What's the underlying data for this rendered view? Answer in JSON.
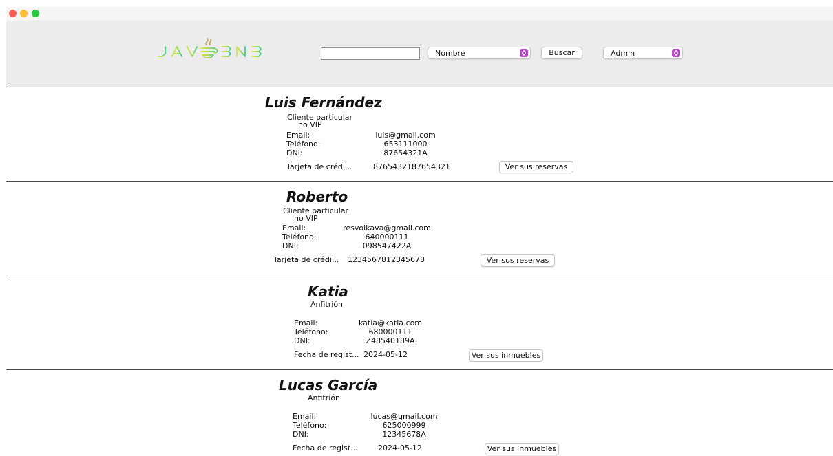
{
  "logo": {
    "text": "JAVABNB"
  },
  "header": {
    "search": {
      "value": "",
      "placeholder": ""
    },
    "filter_select": {
      "selected": "Nombre"
    },
    "search_button": "Buscar",
    "role_select": {
      "selected": "Admin"
    }
  },
  "users": [
    {
      "name": "Luis Fernández",
      "type_line1": "Cliente particular",
      "type_line2": "no VIP",
      "email_label": "Email:",
      "email": "luis@gmail.com",
      "phone_label": "Teléfono:",
      "phone": "653111000",
      "dni_label": "DNI:",
      "dni": "87654321A",
      "extra_label": "Tarjeta de crédi...",
      "extra_value": "8765432187654321",
      "action": "Ver sus reservas"
    },
    {
      "name": "Roberto",
      "type_line1": "Cliente particular",
      "type_line2": "no VIP",
      "email_label": "Email:",
      "email": "resvolkava@gmail.com",
      "phone_label": "Teléfono:",
      "phone": "640000111",
      "dni_label": "DNI:",
      "dni": "098547422A",
      "extra_label": "Tarjeta de crédi...",
      "extra_value": "1234567812345678",
      "action": "Ver sus reservas"
    },
    {
      "name": "Katia",
      "type_line1": "Anfitrión",
      "email_label": "Email:",
      "email": "katia@katia.com",
      "phone_label": "Teléfono:",
      "phone": "680000111",
      "dni_label": "DNI:",
      "dni": "Z48540189A",
      "extra_label": "Fecha de regist...",
      "extra_value": "2024-05-12",
      "action": "Ver sus inmuebles"
    },
    {
      "name": "Lucas García",
      "type_line1": "Anfitrión",
      "email_label": "Email:",
      "email": "lucas@gmail.com",
      "phone_label": "Teléfono:",
      "phone": "625000999",
      "dni_label": "DNI:",
      "dni": "12345678A",
      "extra_label": "Fecha de regist...",
      "extra_value": "2024-05-12",
      "action": "Ver sus inmuebles"
    }
  ],
  "colors": {
    "toolbar_bg": "#ececec",
    "select_arrow": "#b548c6",
    "close": "#fe5f57",
    "minimize": "#febc2e",
    "maximize": "#28c840"
  }
}
